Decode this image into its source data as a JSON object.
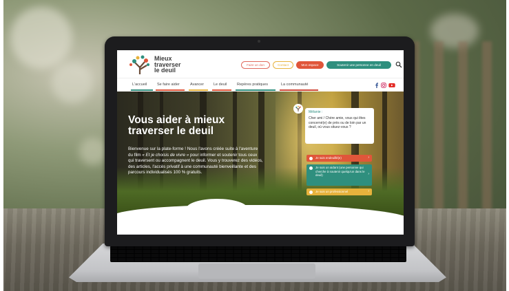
{
  "site": {
    "logo_lines": [
      "Mieux",
      "traverser",
      "le deuil"
    ]
  },
  "header_buttons": [
    {
      "label": "Faire un don",
      "border": "#e0685b",
      "text": "#e0685b",
      "bg": "#ffffff"
    },
    {
      "label": "Contact",
      "border": "#e7b23c",
      "text": "#e7b23c",
      "bg": "#ffffff"
    },
    {
      "label": "Mon espace",
      "border": "#e0563a",
      "text": "#ffffff",
      "bg": "#e0563a"
    },
    {
      "label": "Soutenir une personne en deuil",
      "border": "#2f8f7e",
      "text": "#ffffff",
      "bg": "#2f8f7e"
    }
  ],
  "search_icon": "search-icon",
  "nav": [
    {
      "label": "L'accueil",
      "color": "#2f8f7e",
      "active": true
    },
    {
      "label": "Se faire aider",
      "color": "#e0563a"
    },
    {
      "label": "Avancer",
      "color": "#e7b23c"
    },
    {
      "label": "Le deuil",
      "color": "#e0563a"
    },
    {
      "label": "Repères pratiques",
      "color": "#2f8f7e"
    },
    {
      "label": "La communauté",
      "color": "#d04a3a"
    }
  ],
  "social_icons": [
    "facebook-icon",
    "instagram-icon",
    "youtube-icon"
  ],
  "hero": {
    "title_lines": [
      "Vous aider à mieux",
      "traverser le deuil"
    ],
    "text_before": "Bienvenue sur la plate-forme ! Nous l'avons créée suite à l'aventure du film ",
    "text_film": "« Et je choisis de vivre »",
    "text_after": " pour informer et soutenir tous ceux qui traversent ou accompagnent le deuil. Vous y trouverez des vidéos, des articles, l'accès privatif à une communauté bienveillante et des parcours individualisés 100 % gratuits."
  },
  "chat": {
    "name": "Mélanie :",
    "message": "Cher ami / Chère amie, vous qui êtes concerné(e) de près ou de loin par un deuil, où vous situez-vous ?",
    "choices": [
      {
        "label": "Je suis endeuillé(e)",
        "color": "#e0563a"
      },
      {
        "label": "Je suis un aidant (une personne qui cherche à soutenir quelqu'un dans le deuil)",
        "color": "#2f8f7e"
      },
      {
        "label": "Je suis un professionnel",
        "color": "#e7b23c"
      }
    ]
  },
  "colors": {
    "teal": "#2f8f7e",
    "orange": "#e0563a",
    "yellow": "#e7b23c"
  }
}
